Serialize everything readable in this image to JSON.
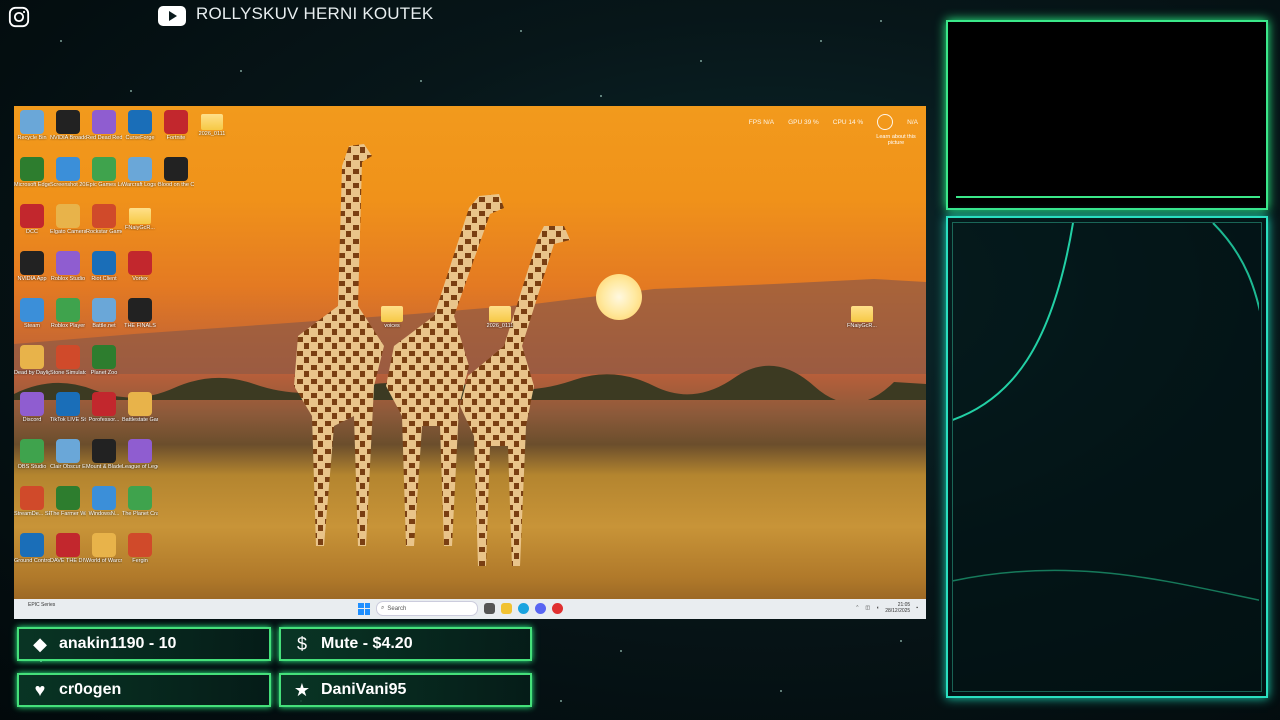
{
  "header": {
    "channel_name": "ROLLYSKUV HERNI KOUTEK",
    "instagram_icon": "instagram-icon",
    "youtube_icon": "youtube-icon"
  },
  "desktop": {
    "icons_col1": [
      "Recycle Bin",
      "Microsoft Edge",
      "DCC",
      "NVIDIA App",
      "Steam",
      "Dead by Daylight",
      "Discord",
      "OBS Studio",
      "StreamDe... SELive",
      "Ground Control"
    ],
    "icons_col2": [
      "NVIDIA Broadcast",
      "Screenshot 2025-07...",
      "Elgato Camera Hub",
      "Roblox Studio",
      "Roblox Player",
      "Stone Simulator",
      "TikTok LIVE Studio",
      "Clair Obscur Expedition 33",
      "The Farmer Was Repl...",
      "DAVE THE DIVER"
    ],
    "icons_col3": [
      "Red Dead Redemptio...",
      "Epic Games Launcher",
      "Rockstar Games...",
      "Riot Client",
      "Battle.net",
      "Planet Zoo",
      "Porofessor...",
      "Mount & Blade II B...",
      "WindowsN...",
      "World of Warcraft"
    ],
    "icons_col4": [
      "CurseForge",
      "Warcraft Logs Com...",
      "FNaiyGcR...",
      "Vortex",
      "THE FINALS",
      "",
      "Battlestate Games L...",
      "League of Legends",
      "The Planet Crafter",
      "Fergin"
    ],
    "icons_col5": [
      "Fortnite",
      "Blood on the Clocktowe..."
    ],
    "icons_col6": [
      "2026_0111"
    ],
    "center_folders": [
      "voices",
      "2026_0111"
    ],
    "right_folder": "FNaiyGcR...",
    "stats": {
      "fps": "FPS  N/A",
      "gpu": "GPU  39 %",
      "cpu": "CPU  14 %",
      "extra": "N/A"
    },
    "learn_more": "Learn about this picture",
    "taskbar": {
      "left_label": "EPIC Series",
      "search_placeholder": "Search",
      "time": "21:05",
      "date": "28/12/2025"
    }
  },
  "alerts": [
    {
      "icon": "diamond-icon",
      "text": "anakin1190 - 10"
    },
    {
      "icon": "dollar-icon",
      "text": "Mute - $4.20"
    },
    {
      "icon": "heart-icon",
      "text": "cr0ogen"
    },
    {
      "icon": "star-icon",
      "text": "DaniVani95"
    }
  ],
  "colors": {
    "accent_green": "#3be88a",
    "accent_teal": "#2adfc0",
    "bg": "#071619"
  }
}
